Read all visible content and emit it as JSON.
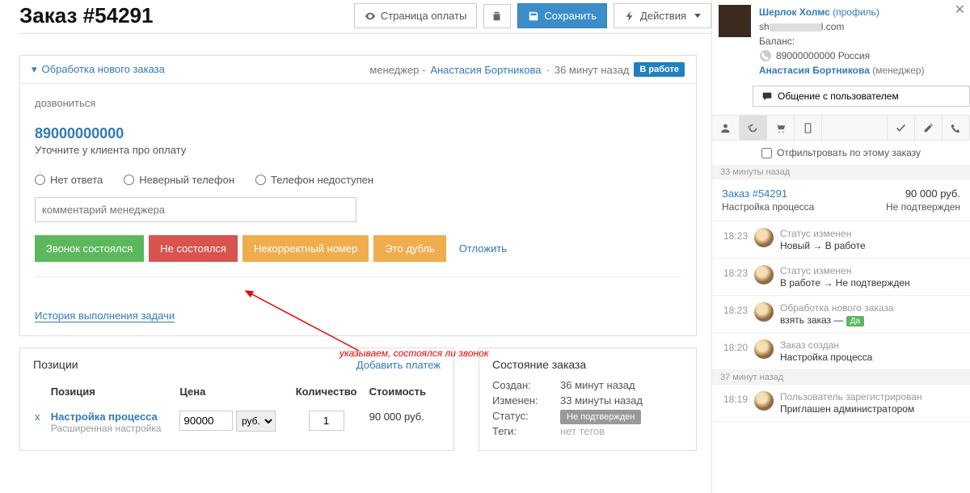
{
  "header": {
    "title": "Заказ #54291",
    "pay_page": "Страница оплаты",
    "save": "Сохранить",
    "actions": "Действия"
  },
  "process": {
    "section_title": "Обработка нового заказа",
    "manager_prefix": "менеджер - ",
    "manager_name": "Анастасия Бортникова",
    "time_ago": "36 минут назад",
    "status_label": "В работе",
    "task_label": "дозвониться",
    "phone": "89000000000",
    "phone_note": "Уточните у клиента про оплату",
    "radio_no_answer": "Нет ответа",
    "radio_bad_phone": "Неверный телефон",
    "radio_unavail": "Телефон недоступен",
    "comment_placeholder": "комментарий менеджера",
    "btn_done": "Звонок состоялся",
    "btn_not_done": "Не состоялся",
    "btn_bad_number": "Некорректный номер",
    "btn_dup": "Это дубль",
    "postpone": "Отложить",
    "history_link": "История выполнения задачи",
    "annotation": "указываем, состоялся ли звонок"
  },
  "positions": {
    "title": "Позиции",
    "add_payment": "Добавить платеж",
    "col_position": "Позиция",
    "col_price": "Цена",
    "col_qty": "Количество",
    "col_cost": "Стоимость",
    "item_name": "Настройка процесса",
    "item_sub": "Расширенная настройка",
    "price": "90000",
    "currency": "руб.",
    "qty": "1",
    "cost": "90 000 руб."
  },
  "order_state": {
    "title": "Состояние заказа",
    "k_created": "Создан:",
    "v_created": "36 минут назад",
    "k_changed": "Изменен:",
    "v_changed": "33 минуты назад",
    "k_status": "Статус:",
    "v_status": "Не подтвержден",
    "k_tags": "Теги:",
    "v_tags": "нет тегов"
  },
  "profile": {
    "name": "Шерлок Холмс",
    "name_suffix": "(профиль)",
    "email_pre": "sh",
    "email_post": "l.com",
    "balance_label": "Баланс:",
    "phone": "89000000000 Россия",
    "manager": "Анастасия Бортникова",
    "manager_role": "(менеджер)",
    "chat_btn": "Общение с пользователем",
    "filter_label": "Отфильтровать по этому заказу"
  },
  "feed": {
    "sep1": "33 минуты назад",
    "order_link": "Заказ #54291",
    "amount": "90 000 руб.",
    "sub_name": "Настройка процесса",
    "sub_status": "Не подтвержден",
    "items": [
      {
        "time": "18:23",
        "hd": "Статус изменен",
        "bd": "Новый → В работе"
      },
      {
        "time": "18:23",
        "hd": "Статус изменен",
        "bd": "В работе → Не подтвержден"
      },
      {
        "time": "18:23",
        "hd": "Обработка нового заказа",
        "bd": "взять заказ —",
        "badge": "Да"
      },
      {
        "time": "18:20",
        "hd": "Заказ создан",
        "bd": "Настройка процесса"
      }
    ],
    "sep2": "37 минут назад",
    "items2": [
      {
        "time": "18:19",
        "hd": "Пользователь зарегистрирован",
        "bd": "Приглашен администратором"
      }
    ]
  }
}
